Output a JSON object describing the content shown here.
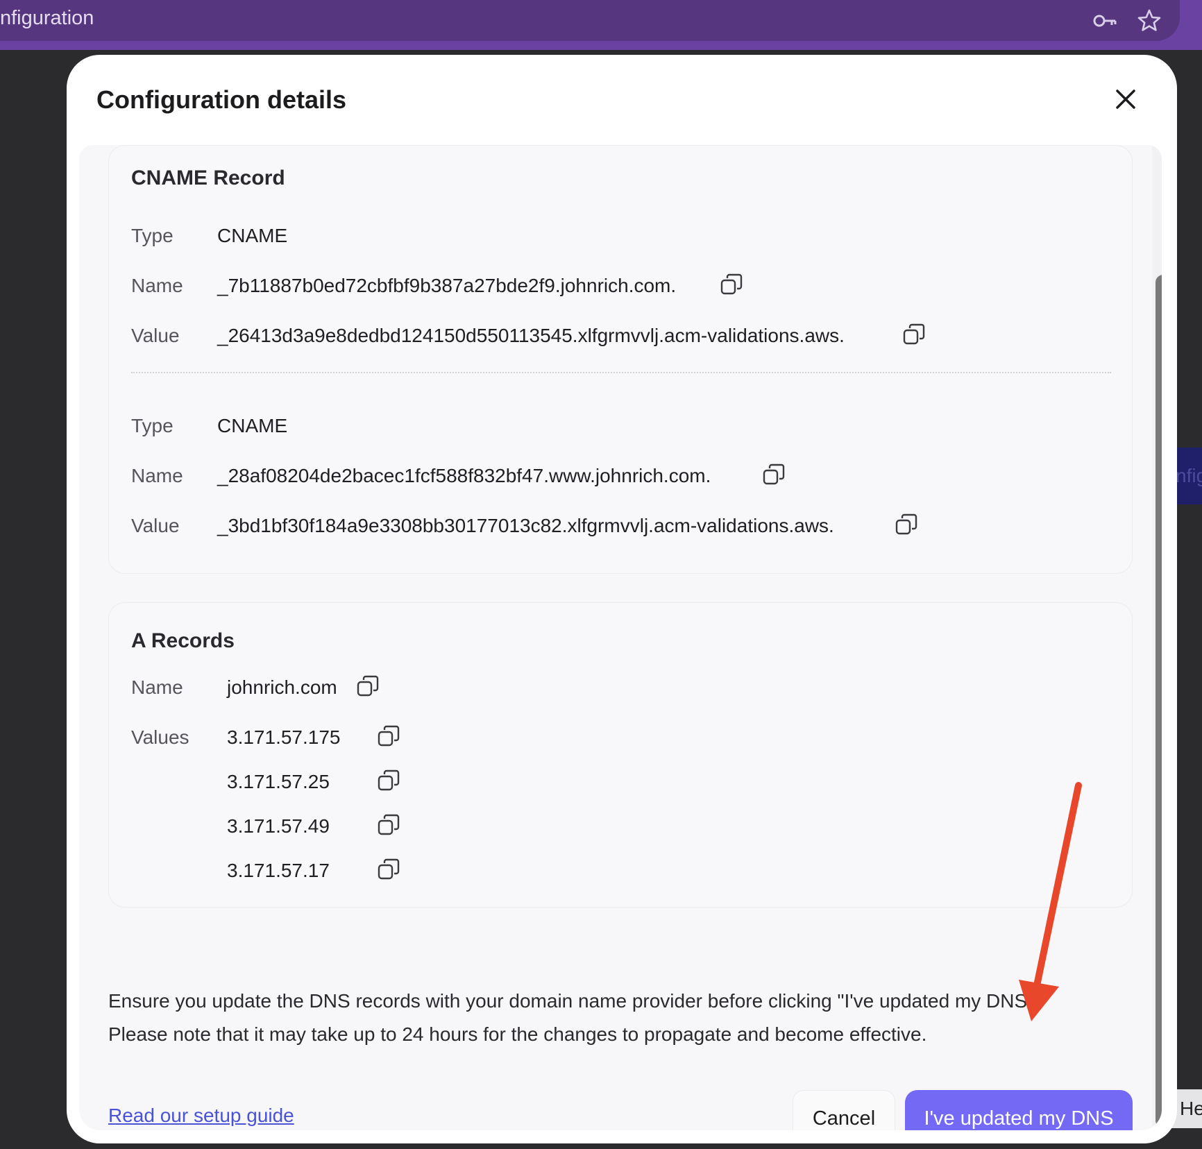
{
  "browser": {
    "tab_title_fragment": "nfiguration",
    "icons": [
      "key-icon",
      "star-icon"
    ]
  },
  "background": {
    "right_button_fragment": "nfig",
    "help_fragment": "He"
  },
  "modal": {
    "title": "Configuration details",
    "cname": {
      "title": "CNAME Record",
      "records": [
        {
          "type_label": "Type",
          "type_value": "CNAME",
          "name_label": "Name",
          "name_value": "_7b11887b0ed72cbfbf9b387a27bde2f9.johnrich.com.",
          "value_label": "Value",
          "value_value": "_26413d3a9e8dedbd124150d550113545.xlfgrmvvlj.acm-validations.aws."
        },
        {
          "type_label": "Type",
          "type_value": "CNAME",
          "name_label": "Name",
          "name_value": "_28af08204de2bacec1fcf588f832bf47.www.johnrich.com.",
          "value_label": "Value",
          "value_value": "_3bd1bf30f184a9e3308bb30177013c82.xlfgrmvvlj.acm-validations.aws."
        }
      ]
    },
    "a_records": {
      "title": "A Records",
      "name_label": "Name",
      "name_value": "johnrich.com",
      "values_label": "Values",
      "values": [
        "3.171.57.175",
        "3.171.57.25",
        "3.171.57.49",
        "3.171.57.17"
      ]
    },
    "note_line1": "Ensure you update the DNS records with your domain name provider before clicking \"I've updated my DNS\"",
    "note_line2": "Please note that it may take up to 24 hours for the changes to propagate and become effective.",
    "guide_link": "Read our setup guide",
    "cancel_label": "Cancel",
    "primary_label": "I've updated my DNS"
  },
  "colors": {
    "browser_bar": "#56367e",
    "primary_button": "#7469f4",
    "link": "#4a52d6",
    "annotation_arrow": "#e8472b"
  }
}
